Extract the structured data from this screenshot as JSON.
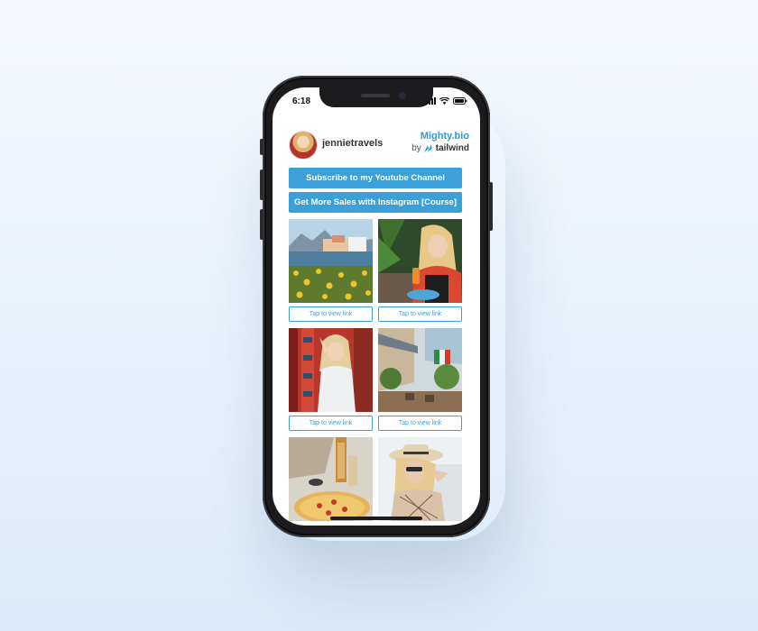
{
  "status_bar": {
    "time": "6:18"
  },
  "profile": {
    "username": "jennietravels"
  },
  "brand": {
    "name": "Mighty.bio",
    "by": "by",
    "partner": "tailwind"
  },
  "buttons": [
    {
      "label": "Subscribe to my Youtube Channel"
    },
    {
      "label": "Get More Sales with Instagram [Course]"
    }
  ],
  "grid": [
    {
      "subject": "lake-town-photo",
      "link_label": "Tap to view link"
    },
    {
      "subject": "woman-drink-photo",
      "link_label": "Tap to view link"
    },
    {
      "subject": "woman-red-door-photo",
      "link_label": "Tap to view link"
    },
    {
      "subject": "cafe-street-photo",
      "link_label": "Tap to view link"
    },
    {
      "subject": "pizza-table-photo",
      "link_label": ""
    },
    {
      "subject": "woman-hat-photo",
      "link_label": ""
    }
  ],
  "colors": {
    "accent": "#3b9fd8",
    "brand": "#2e9bd6"
  }
}
